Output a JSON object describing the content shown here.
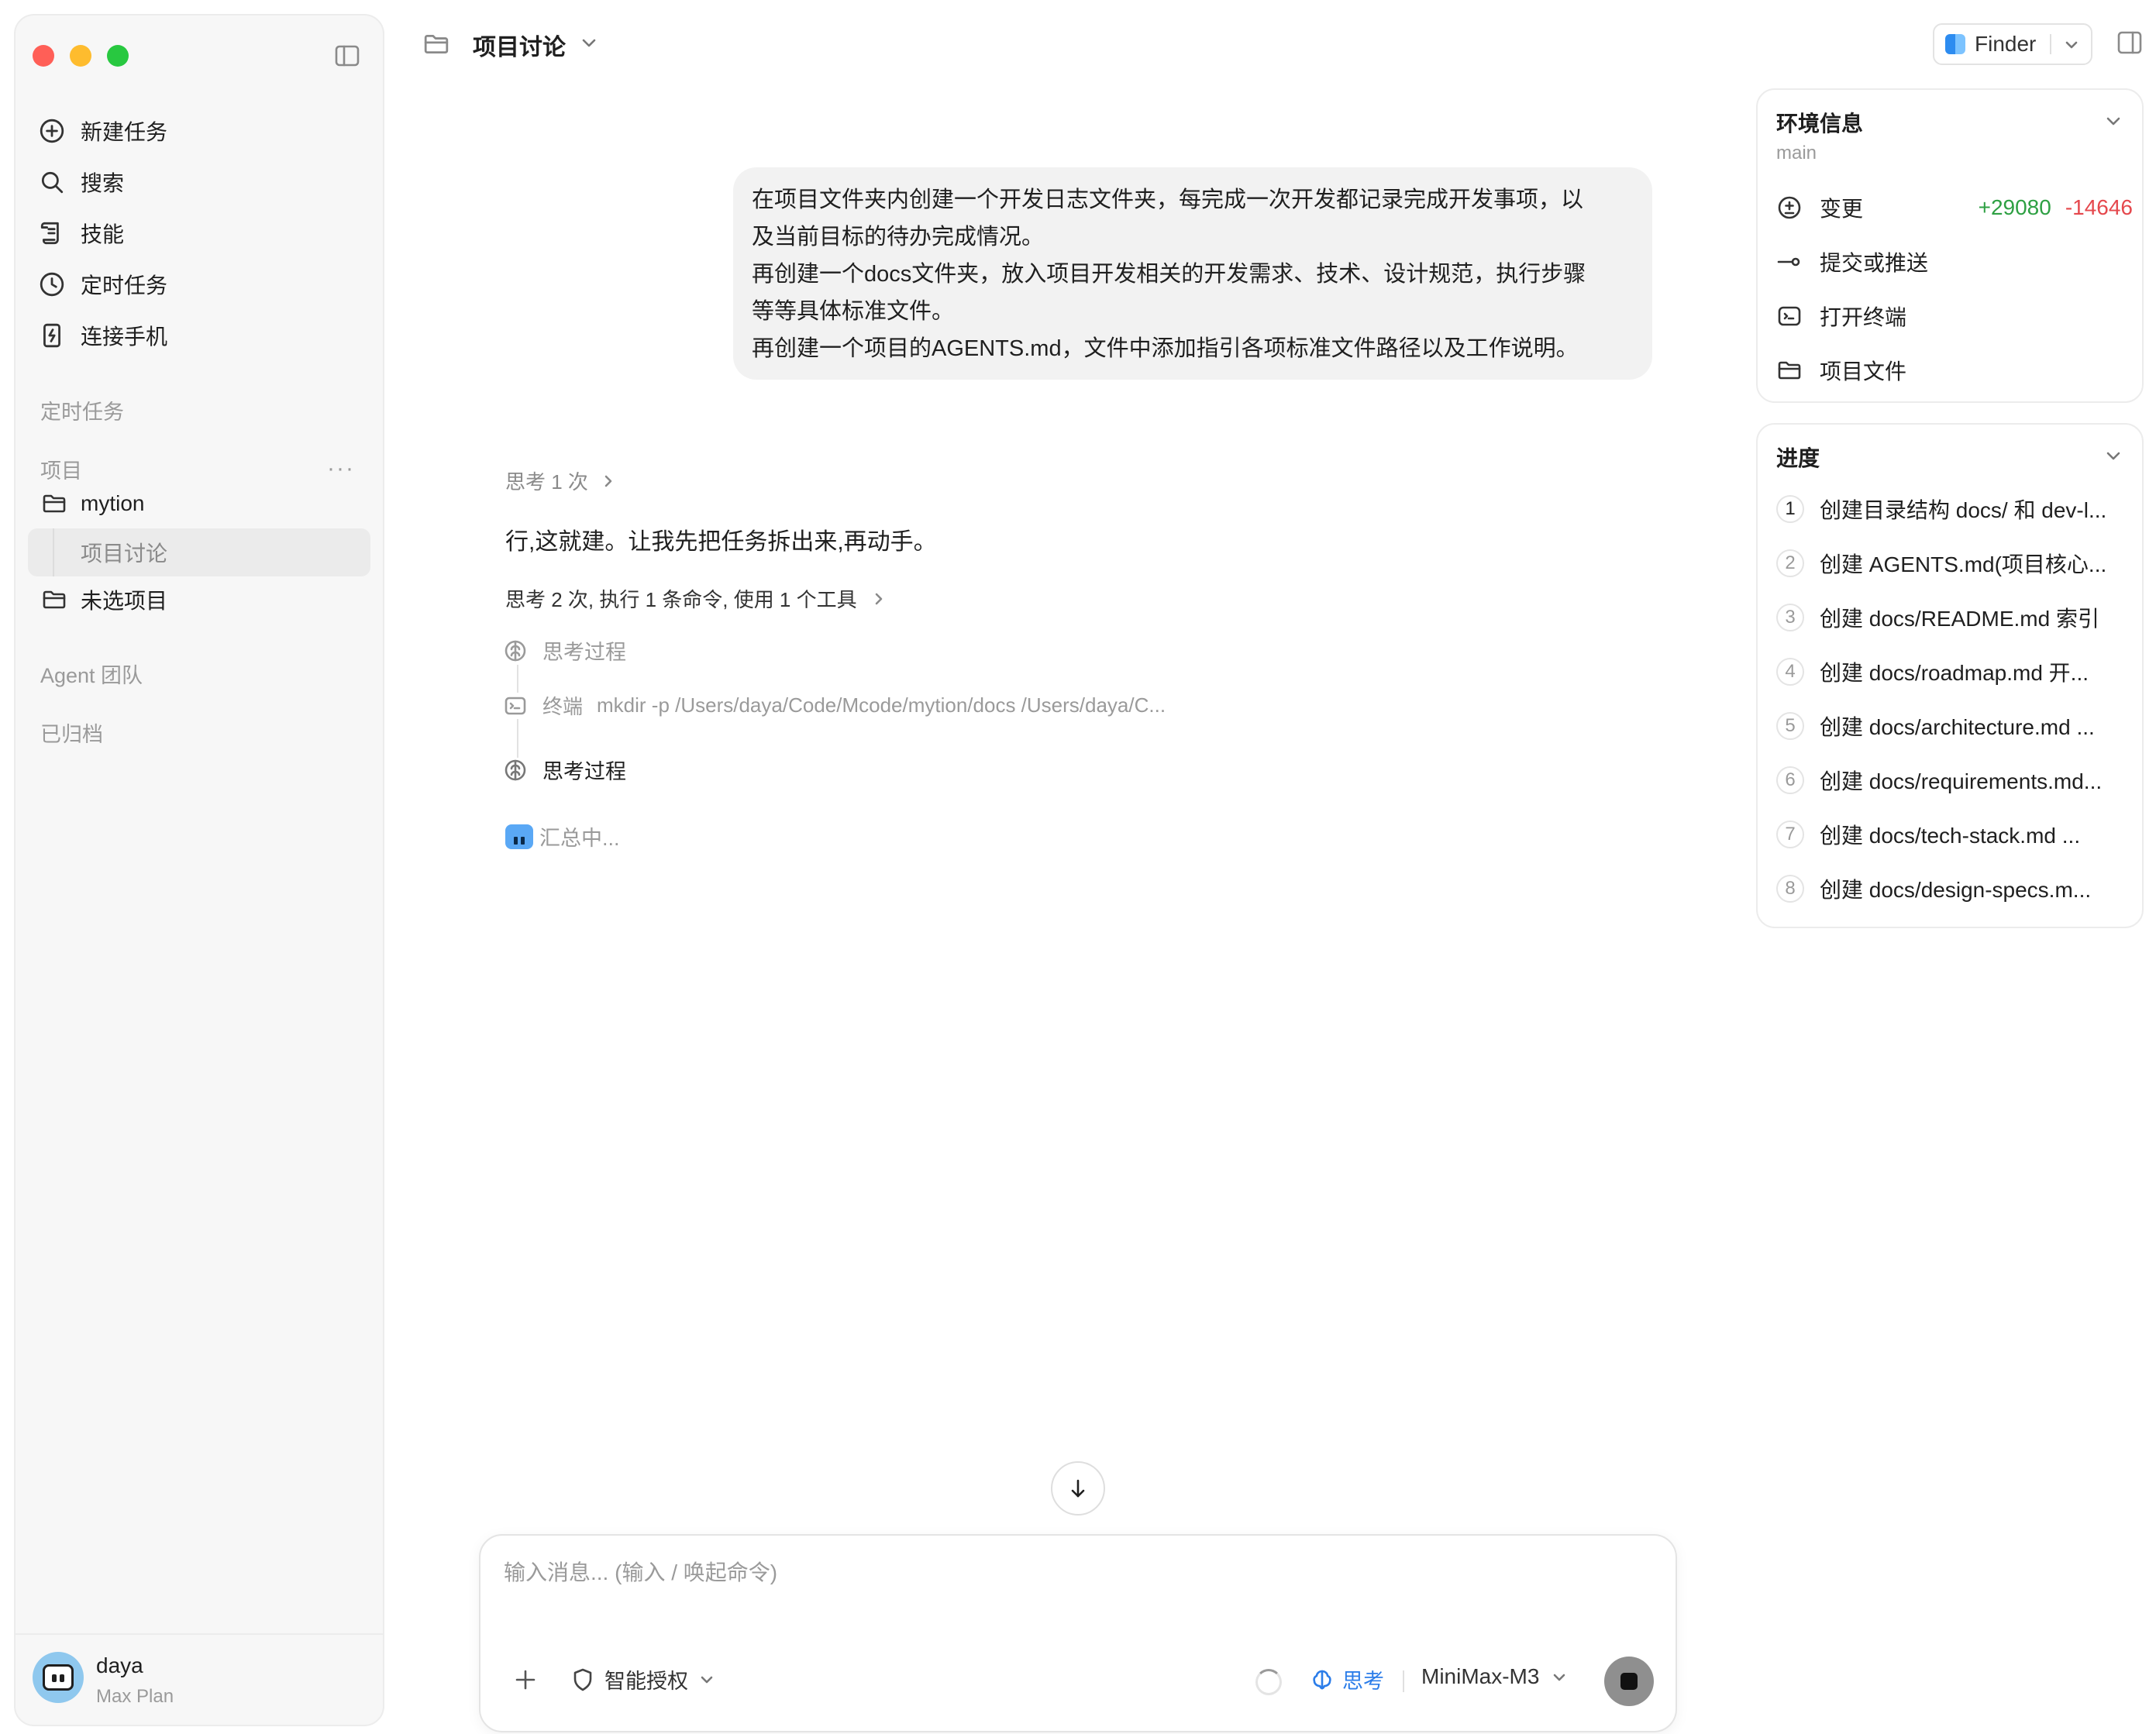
{
  "window": {
    "traffic_lights": {
      "close": "#ff5f57",
      "minimize": "#febc2e",
      "zoom": "#28c840"
    }
  },
  "sidebar": {
    "nav": [
      {
        "label": "新建任务",
        "icon": "plus-circle-icon"
      },
      {
        "label": "搜索",
        "icon": "search-icon"
      },
      {
        "label": "技能",
        "icon": "scroll-icon"
      },
      {
        "label": "定时任务",
        "icon": "clock-icon"
      },
      {
        "label": "连接手机",
        "icon": "phone-icon"
      }
    ],
    "scheduled_label": "定时任务",
    "projects_label": "项目",
    "projects_more": "···",
    "projects": [
      {
        "name": "mytion",
        "icon": "folder-icon",
        "children": [
          {
            "name": "项目讨论",
            "active": true
          }
        ]
      },
      {
        "name": "未选项目",
        "icon": "folder-icon"
      }
    ],
    "agent_team_label": "Agent 团队",
    "archived_label": "已归档",
    "user": {
      "name": "daya",
      "plan": "Max Plan"
    }
  },
  "topbar": {
    "title": "项目讨论",
    "finder_label": "Finder"
  },
  "chat": {
    "user_message": [
      "在项目文件夹内创建一个开发日志文件夹，每完成一次开发都记录完成开发事项，以",
      "及当前目标的待办完成情况。",
      "再创建一个docs文件夹，放入项目开发相关的开发需求、技术、设计规范，执行步骤",
      "等等具体标准文件。",
      "再创建一个项目的AGENTS.md，文件中添加指引各项标准文件路径以及工作说明。"
    ],
    "think_meta": "思考 1 次",
    "reply": "行,这就建。让我先把任务拆出来,再动手。",
    "steps_summary": "思考 2 次, 执行 1 条命令, 使用 1 个工具",
    "steps": [
      {
        "label": "思考过程",
        "icon": "brain-icon"
      },
      {
        "label": "终端",
        "command": "mkdir -p /Users/daya/Code/Mcode/mytion/docs /Users/daya/C...",
        "icon": "terminal-icon"
      },
      {
        "label": "思考过程",
        "icon": "brain-icon"
      }
    ],
    "status": "汇总中..."
  },
  "composer": {
    "placeholder": "输入消息... (输入 / 唤起命令)",
    "permission_label": "智能授权",
    "think_label": "思考",
    "model": "MiniMax-M3",
    "accent_color": "#2b7de9"
  },
  "env_panel": {
    "title": "环境信息",
    "branch": "main",
    "changes_label": "变更",
    "additions": "+29080",
    "deletions": "-14646",
    "commit_label": "提交或推送",
    "terminal_label": "打开终端",
    "files_label": "项目文件",
    "add_color": "#2ea043",
    "del_color": "#e5484d"
  },
  "progress_panel": {
    "title": "进度",
    "items": [
      {
        "num": "1",
        "text": "创建目录结构 docs/ 和 dev-l..."
      },
      {
        "num": "2",
        "text": "创建 AGENTS.md(项目核心..."
      },
      {
        "num": "3",
        "text": "创建 docs/README.md 索引"
      },
      {
        "num": "4",
        "text": "创建 docs/roadmap.md 开..."
      },
      {
        "num": "5",
        "text": "创建 docs/architecture.md ..."
      },
      {
        "num": "6",
        "text": "创建 docs/requirements.md..."
      },
      {
        "num": "7",
        "text": "创建 docs/tech-stack.md ..."
      },
      {
        "num": "8",
        "text": "创建 docs/design-specs.m..."
      }
    ]
  }
}
